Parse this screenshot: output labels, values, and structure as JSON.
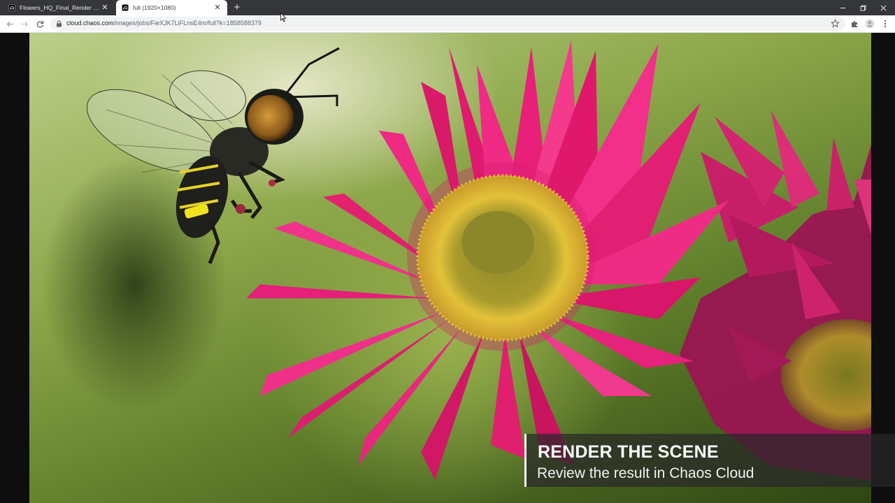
{
  "browser": {
    "tabs": [
      {
        "title": "Flowers_HQ_Final_Render - Proje",
        "favicon": "chaos-cloud-icon",
        "active": false
      },
      {
        "title": "full (1920×1080)",
        "favicon": "chaos-cloud-icon",
        "active": true
      }
    ],
    "new_tab_label": "+",
    "address": {
      "host": "cloud.chaos.com",
      "path": "/images/jobs/FieXJK7LiFLnsE4m/full?k=1858588379"
    },
    "icons": {
      "back": "arrow-left-icon",
      "forward": "arrow-right-icon",
      "reload": "reload-icon",
      "lock": "lock-icon",
      "bookmark": "star-icon",
      "extensions": "puzzle-icon",
      "profile": "avatar-icon",
      "menu": "kebab-menu-icon"
    }
  },
  "caption": {
    "headline": "RENDER THE SCENE",
    "subtitle": "Review the result in Chaos Cloud"
  },
  "colors": {
    "tabstrip": "#35363a",
    "petal_pink": "#e0176f",
    "flower_center": "#e3c23a",
    "caption_bg": "#282828"
  }
}
